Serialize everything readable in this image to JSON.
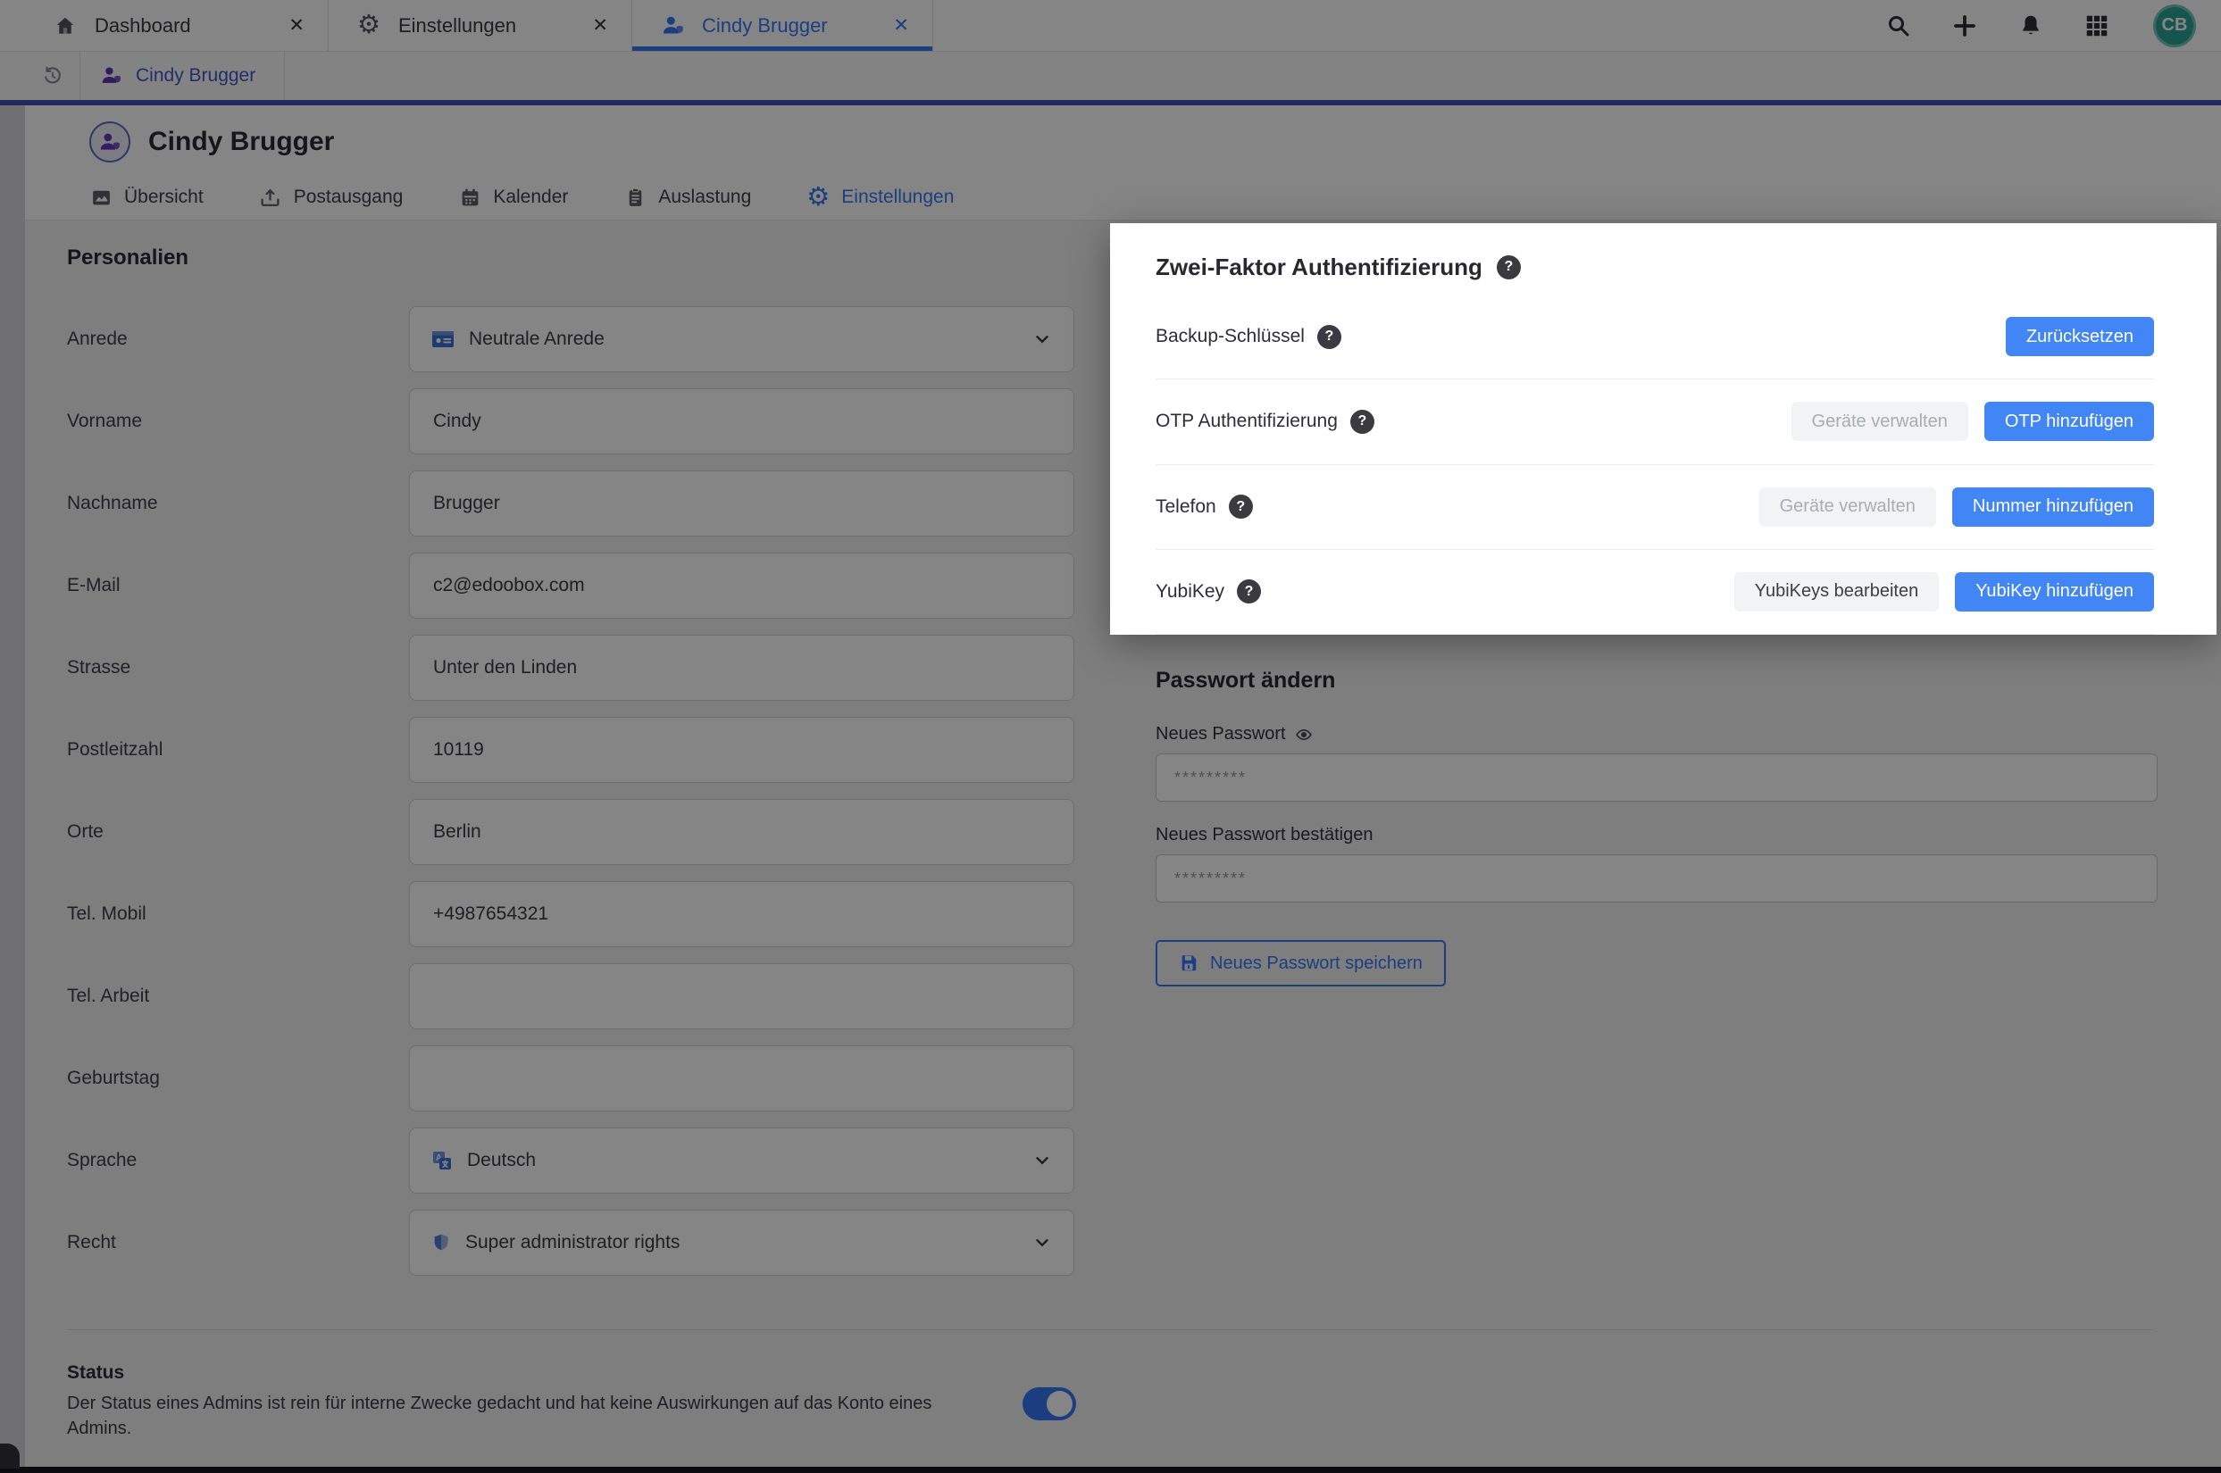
{
  "colors": {
    "primary_blue": "#4285f4",
    "active_tab_blue": "#3478f6",
    "indigo_line": "#3f51b5",
    "purple_icon": "#5e35b1",
    "avatar_teal": "#2aa394",
    "overlay": "rgba(0,0,0,0.48)"
  },
  "topbar": {
    "tabs": [
      {
        "label": "Dashboard",
        "icon": "home-icon",
        "close": "✕"
      },
      {
        "label": "Einstellungen",
        "icon": "gear-icon",
        "close": "✕",
        "gear_glyph": "⚙"
      },
      {
        "label": "Cindy Brugger",
        "icon": "user-shield-icon",
        "close": "✕"
      }
    ],
    "avatar_initials": "CB"
  },
  "subbar": {
    "tab_label": "Cindy Brugger"
  },
  "header": {
    "title": "Cindy Brugger",
    "tabs": [
      {
        "label": "Übersicht"
      },
      {
        "label": "Postausgang"
      },
      {
        "label": "Kalender"
      },
      {
        "label": "Auslastung"
      },
      {
        "label": "Einstellungen",
        "gear_glyph": "⚙"
      }
    ]
  },
  "form": {
    "section_title": "Personalien",
    "fields": [
      {
        "label": "Anrede",
        "type": "select",
        "value": "Neutrale Anrede"
      },
      {
        "label": "Vorname",
        "type": "text",
        "value": "Cindy"
      },
      {
        "label": "Nachname",
        "type": "text",
        "value": "Brugger"
      },
      {
        "label": "E-Mail",
        "type": "text",
        "value": "c2@edoobox.com"
      },
      {
        "label": "Strasse",
        "type": "text",
        "value": "Unter den Linden"
      },
      {
        "label": "Postleitzahl",
        "type": "text",
        "value": "10119"
      },
      {
        "label": "Orte",
        "type": "text",
        "value": "Berlin"
      },
      {
        "label": "Tel. Mobil",
        "type": "text",
        "value": "+4987654321"
      },
      {
        "label": "Tel. Arbeit",
        "type": "text",
        "value": ""
      },
      {
        "label": "Geburtstag",
        "type": "text",
        "value": ""
      },
      {
        "label": "Sprache",
        "type": "select",
        "value": "Deutsch"
      },
      {
        "label": "Recht",
        "type": "select",
        "value": "Super administrator rights"
      }
    ],
    "status": {
      "label": "Status",
      "description": "Der Status eines Admins ist rein für interne Zwecke gedacht und hat keine Auswirkungen auf das Konto eines Admins.",
      "enabled": true
    }
  },
  "twofa": {
    "title": "Zwei-Faktor Authentifizierung",
    "help": "?",
    "rows": [
      {
        "label": "Backup-Schlüssel",
        "help": "?",
        "buttons": [
          {
            "label": "Zurücksetzen",
            "style": "primary"
          }
        ]
      },
      {
        "label": "OTP Authentifizierung",
        "help": "?",
        "buttons": [
          {
            "label": "Geräte verwalten",
            "style": "disabled"
          },
          {
            "label": "OTP hinzufügen",
            "style": "primary"
          }
        ]
      },
      {
        "label": "Telefon",
        "help": "?",
        "buttons": [
          {
            "label": "Geräte verwalten",
            "style": "disabled"
          },
          {
            "label": "Nummer hinzufügen",
            "style": "primary"
          }
        ]
      },
      {
        "label": "YubiKey",
        "help": "?",
        "buttons": [
          {
            "label": "YubiKeys bearbeiten",
            "style": "light"
          },
          {
            "label": "YubiKey hinzufügen",
            "style": "primary"
          }
        ]
      }
    ]
  },
  "password": {
    "title": "Passwort ändern",
    "fields": [
      {
        "label": "Neues Passwort",
        "placeholder": "*********"
      },
      {
        "label": "Neues Passwort bestätigen",
        "placeholder": "*********"
      }
    ],
    "save_label": "Neues Passwort speichern"
  }
}
